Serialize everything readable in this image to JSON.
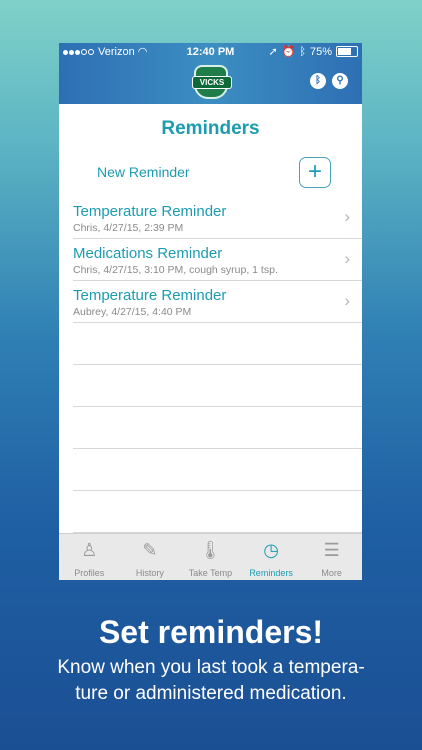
{
  "status_bar": {
    "carrier": "Verizon",
    "time": "12:40 PM",
    "battery": "75%"
  },
  "header": {
    "logo_text": "VICKS",
    "bluetooth_icon": "bluetooth-icon",
    "thermometer_icon": "thermometer-icon"
  },
  "page": {
    "title": "Reminders",
    "new_reminder_label": "New Reminder",
    "add_symbol": "+"
  },
  "reminders": [
    {
      "title": "Temperature Reminder",
      "detail": "Chris, 4/27/15, 2:39 PM"
    },
    {
      "title": "Medications Reminder",
      "detail": "Chris, 4/27/15, 3:10 PM, cough syrup, 1 tsp."
    },
    {
      "title": "Temperature Reminder",
      "detail": "Aubrey, 4/27/15, 4:40 PM"
    }
  ],
  "tabs": [
    {
      "label": "Profiles",
      "icon": "person-icon",
      "glyph": "♙"
    },
    {
      "label": "History",
      "icon": "history-icon",
      "glyph": "✎"
    },
    {
      "label": "Take Temp",
      "icon": "thermometer-icon",
      "glyph": "🌡"
    },
    {
      "label": "Reminders",
      "icon": "clock-icon",
      "glyph": "◷"
    },
    {
      "label": "More",
      "icon": "menu-icon",
      "glyph": "☰"
    }
  ],
  "caption": {
    "heading": "Set reminders!",
    "line1": "Know when you last took a tempera-",
    "line2": "ture or administered medication."
  },
  "colors": {
    "accent": "#1c9cb0",
    "header": "#2e6fb4"
  }
}
